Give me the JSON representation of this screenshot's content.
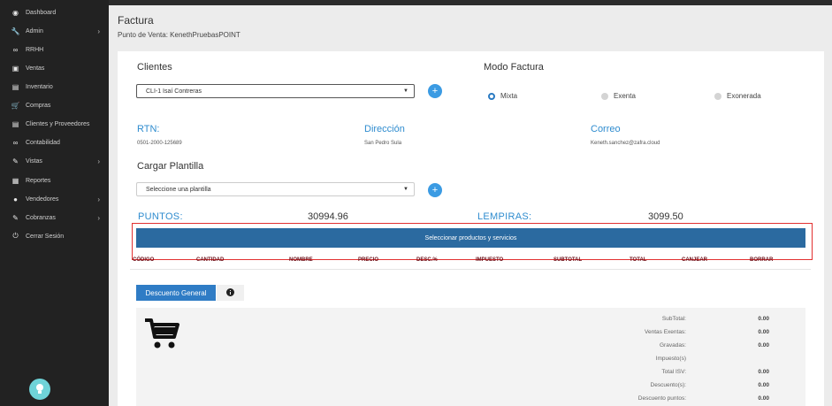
{
  "sidebar": {
    "items": [
      {
        "label": "Dashboard",
        "icon": "dashboard-icon",
        "glyph": "◉",
        "chevron": false
      },
      {
        "label": "Admin",
        "icon": "wrench-icon",
        "glyph": "🔧",
        "chevron": true
      },
      {
        "label": "RRHH",
        "icon": "link-icon",
        "glyph": "∞",
        "chevron": false
      },
      {
        "label": "Ventas",
        "icon": "money-icon",
        "glyph": "▣",
        "chevron": false
      },
      {
        "label": "Inventario",
        "icon": "book-icon",
        "glyph": "▤",
        "chevron": false
      },
      {
        "label": "Compras",
        "icon": "cart-icon",
        "glyph": "🛒",
        "chevron": false
      },
      {
        "label": "Clientes y Proveedores",
        "icon": "book-icon",
        "glyph": "▤",
        "chevron": false
      },
      {
        "label": "Contabilidad",
        "icon": "link-icon",
        "glyph": "∞",
        "chevron": false
      },
      {
        "label": "Vistas",
        "icon": "edit-icon",
        "glyph": "✎",
        "chevron": true
      },
      {
        "label": "Reportes",
        "icon": "list-icon",
        "glyph": "▦",
        "chevron": false
      },
      {
        "label": "Vendedores",
        "icon": "user-icon",
        "glyph": "●",
        "chevron": true
      },
      {
        "label": "Cobranzas",
        "icon": "edit-icon",
        "glyph": "✎",
        "chevron": true
      },
      {
        "label": "Cerrar Sesión",
        "icon": "power-icon",
        "glyph": "⏻",
        "chevron": false
      }
    ]
  },
  "header": {
    "title": "Factura",
    "subtitle": "Punto de Venta: KenethPruebasPOINT"
  },
  "clientes": {
    "label": "Clientes",
    "selected": "CLI-1  Isaí Contreras"
  },
  "modo": {
    "label": "Modo Factura",
    "options": [
      {
        "label": "Mixta",
        "selected": true
      },
      {
        "label": "Exenta",
        "selected": false
      },
      {
        "label": "Exonerada",
        "selected": false
      }
    ]
  },
  "info": {
    "rtn_label": "RTN:",
    "rtn_value": "0501-2000-125689",
    "dir_label": "Dirección",
    "dir_value": "San Pedro Sula",
    "correo_label": "Correo",
    "correo_value": "Keneth.sanchez@zafra.cloud"
  },
  "plantilla": {
    "label": "Cargar Plantilla",
    "selected": "Seleccione una plantilla"
  },
  "puntos": {
    "label": "PUNTOS:",
    "value": "30994.96",
    "lempiras_label": "LEMPIRAS:",
    "lempiras_value": "3099.50"
  },
  "products_button": "Seleccionar productos y servicios",
  "table": {
    "headers": [
      "CÓDIGO",
      "CANTIDAD",
      "NOMBRE",
      "PRECIO",
      "DESC.%",
      "IMPUESTO",
      "SUBTOTAL",
      "TOTAL",
      "CANJEAR",
      "BORRAR"
    ]
  },
  "tabs": {
    "descuento": "Descuento General"
  },
  "summary": {
    "rows": [
      {
        "label": "SubTotal:",
        "value": "0.00"
      },
      {
        "label": "Ventas Exentas:",
        "value": "0.00"
      },
      {
        "label": "Gravadas:",
        "value": "0.00"
      },
      {
        "label": "Impuesto(s)",
        "value": ""
      },
      {
        "label": "Total ISV:",
        "value": "0.00"
      },
      {
        "label": "Descuento(s):",
        "value": "0.00"
      },
      {
        "label": "Descuento puntos:",
        "value": "0.00"
      }
    ]
  },
  "colors": {
    "accent": "#2f8ccf",
    "button": "#2b6aa0",
    "highlight": "#e23030",
    "sidebar": "#222222"
  }
}
